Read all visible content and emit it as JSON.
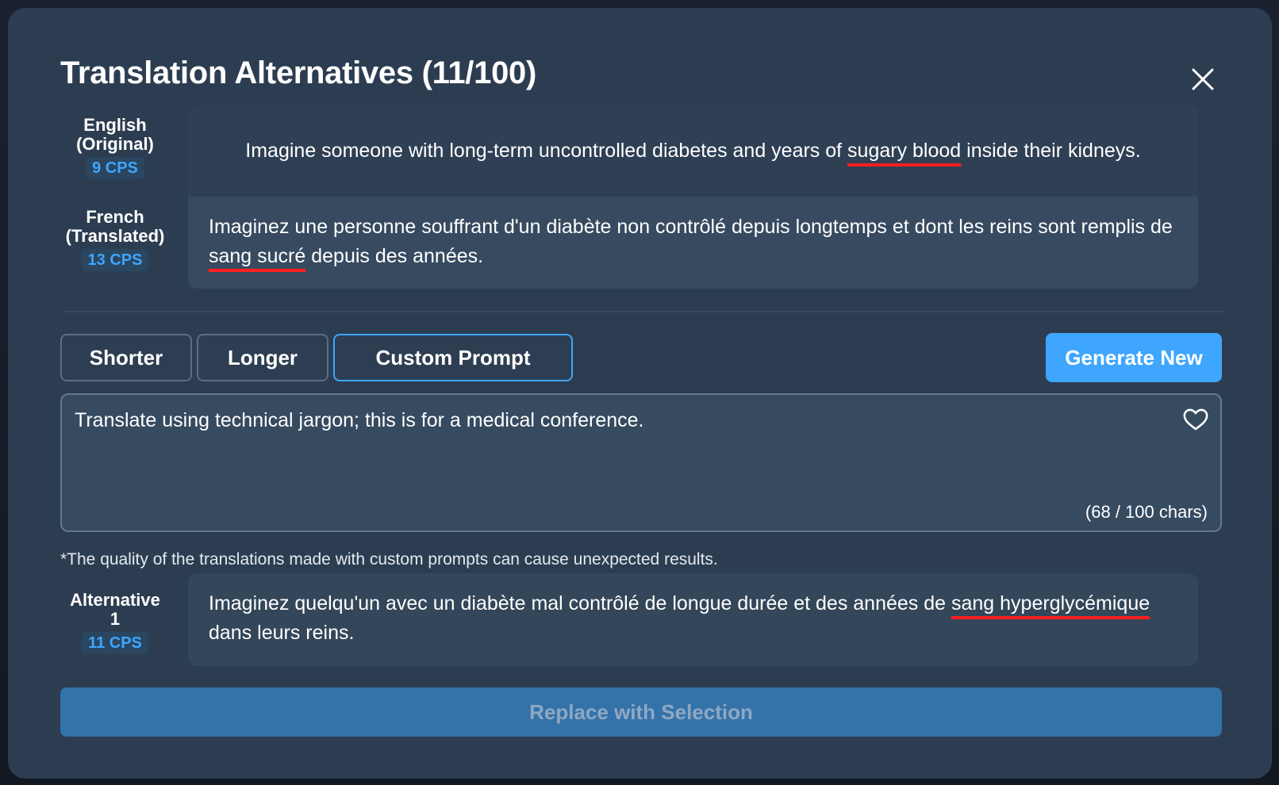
{
  "dialog": {
    "title": "Translation Alternatives (11/100)"
  },
  "original": {
    "label_line1": "English",
    "label_line2": "(Original)",
    "cps": "9 CPS",
    "text_before": "Imagine someone with long-term uncontrolled diabetes and years of ",
    "text_highlight": "sugary blood",
    "text_after": " inside their kidneys."
  },
  "translated": {
    "label_line1": "French",
    "label_line2": "(Translated)",
    "cps": "13 CPS",
    "text_before": "Imaginez une personne souffrant d'un diabète non contrôlé depuis longtemps et dont les reins sont remplis de ",
    "text_highlight": "sang sucré",
    "text_after": " depuis des années."
  },
  "tabs": [
    {
      "label": "Shorter"
    },
    {
      "label": "Longer"
    },
    {
      "label": "Custom Prompt",
      "active": true
    }
  ],
  "generate_button": "Generate New",
  "prompt": {
    "value": "Translate using technical jargon; this is for a medical conference.",
    "char_count": "(68 / 100 chars)"
  },
  "disclaimer": "*The quality of the translations made with custom prompts can cause unexpected results.",
  "alternative": {
    "label": "Alternative 1",
    "cps": "11 CPS",
    "text_before": "Imaginez quelqu'un avec un diabète mal contrôlé de longue durée et des années de ",
    "text_highlight": "sang hyperglycémique",
    "text_after": " dans leurs reins."
  },
  "replace_button": "Replace with Selection",
  "colors": {
    "accent": "#3ea6ff",
    "annotation_underline": "#ff1f1f",
    "modal_bg": "#2d3d51"
  },
  "icons": [
    "close-icon",
    "heart-icon"
  ]
}
